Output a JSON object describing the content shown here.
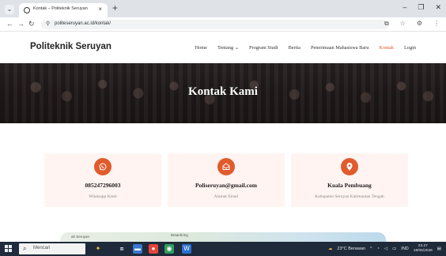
{
  "browser": {
    "tab_title": "Kontak – Politeknik Seruyan",
    "url": "politeseruyan.ac.id/kontak/",
    "new_tab_glyph": "+",
    "close_glyph": "×"
  },
  "site": {
    "brand": "Politeknik Seruyan",
    "menu": [
      {
        "label": "Home",
        "active": false
      },
      {
        "label": "Tentang ⌄",
        "active": false
      },
      {
        "label": "Program Studi",
        "active": false
      },
      {
        "label": "Berita",
        "active": false
      },
      {
        "label": "Penerimaan Mahasiswa Baru",
        "active": false
      },
      {
        "label": "Kontak",
        "active": true
      },
      {
        "label": "Login",
        "active": false
      }
    ],
    "hero_title": "Kontak Kami",
    "accent_color": "#e05b2d"
  },
  "cards": [
    {
      "icon": "whatsapp-icon",
      "title": "085247296003",
      "subtitle": "Whatsapp Kami"
    },
    {
      "icon": "email-icon",
      "title": "Poliseruyan@gmail.com",
      "subtitle": "Alamat Email"
    },
    {
      "icon": "location-pin-icon",
      "title": "Kuala Pembuang",
      "subtitle": "Kabupaten Seruyan Kalimantan Tengah"
    }
  ],
  "map": {
    "label_left": "ah Seruyan",
    "label_mid": "Betanhring"
  },
  "taskbar": {
    "search_placeholder": "Mencari",
    "weather": "23°C Berawan",
    "language": "IND",
    "time": "23.27",
    "date": "18/05/2026"
  }
}
